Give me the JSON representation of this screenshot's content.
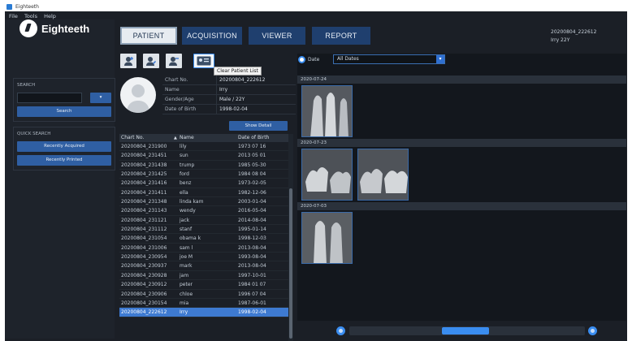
{
  "window": {
    "title": "Eighteeth"
  },
  "menu": [
    "File",
    "Tools",
    "Help"
  ],
  "logo": {
    "text": "Eighteeth"
  },
  "search": {
    "label": "SEARCH",
    "dropdown_symbol": "▾",
    "button": "Search"
  },
  "quick_search": {
    "label": "QUICK SEARCH",
    "buttons": [
      "Recently Acquired",
      "Recently Printed"
    ]
  },
  "tabs": [
    "PATIENT",
    "ACQUISITION",
    "VIEWER",
    "REPORT"
  ],
  "user": {
    "id": "20200804_222612",
    "name": "Irry 22Y"
  },
  "toolbar": {
    "tooltip": "Clear Patient List"
  },
  "patient": {
    "fields": [
      {
        "k": "Chart No.",
        "v": "20200804_222612"
      },
      {
        "k": "Name",
        "v": "Irry"
      },
      {
        "k": "Gender/Age",
        "v": "Male / 22Y"
      },
      {
        "k": "Date of Birth",
        "v": "1998-02-04"
      }
    ],
    "show_detail": "Show Detail"
  },
  "list": {
    "headers": {
      "chart": "Chart No.",
      "name": "Name",
      "dob": "Date of Birth",
      "sort_icon": "▲"
    },
    "rows": [
      {
        "chart": "20200804_231900",
        "name": "lily",
        "dob": "1973 07 16"
      },
      {
        "chart": "20200804_231451",
        "name": "sun",
        "dob": "2013 05 01"
      },
      {
        "chart": "20200804_231438",
        "name": "trump",
        "dob": "1985 05-30"
      },
      {
        "chart": "20200804_231425",
        "name": "ford",
        "dob": "1984 08 04"
      },
      {
        "chart": "20200804_231416",
        "name": "benz",
        "dob": "1973-02-05"
      },
      {
        "chart": "20200804_231411",
        "name": "ella",
        "dob": "1982-12-06"
      },
      {
        "chart": "20200804_231348",
        "name": "linda kam",
        "dob": "2003-01-04"
      },
      {
        "chart": "20200804_231143",
        "name": "wendy",
        "dob": "2016-05-04"
      },
      {
        "chart": "20200804_231121",
        "name": "jack",
        "dob": "2014-08-04"
      },
      {
        "chart": "20200804_231112",
        "name": "stanf",
        "dob": "1995-01-14"
      },
      {
        "chart": "20200804_231054",
        "name": "obama k",
        "dob": "1998-12-03"
      },
      {
        "chart": "20200804_231006",
        "name": "sam l",
        "dob": "2013-08-04"
      },
      {
        "chart": "20200804_230954",
        "name": "joe M",
        "dob": "1993-08-04"
      },
      {
        "chart": "20200804_230937",
        "name": "mark",
        "dob": "2013-08-04"
      },
      {
        "chart": "20200804_230928",
        "name": "jam",
        "dob": "1997-10-01"
      },
      {
        "chart": "20200804_230912",
        "name": "peter",
        "dob": "1984 01 07"
      },
      {
        "chart": "20200804_230906",
        "name": "chloe",
        "dob": "1996 07 04"
      },
      {
        "chart": "20200804_230154",
        "name": "mia",
        "dob": "1987-06-01"
      },
      {
        "chart": "20200804_222612",
        "name": "Irry",
        "dob": "1998-02-04"
      }
    ],
    "selected_index": 18
  },
  "viewer": {
    "date_radio_label": "Date",
    "date_filter": "All Dates",
    "dropdown_symbol": "▾",
    "groups": [
      {
        "date": "2020-07-24",
        "images": 1
      },
      {
        "date": "2020-07-23",
        "images": 2
      },
      {
        "date": "2020-07-03",
        "images": 1
      }
    ]
  }
}
